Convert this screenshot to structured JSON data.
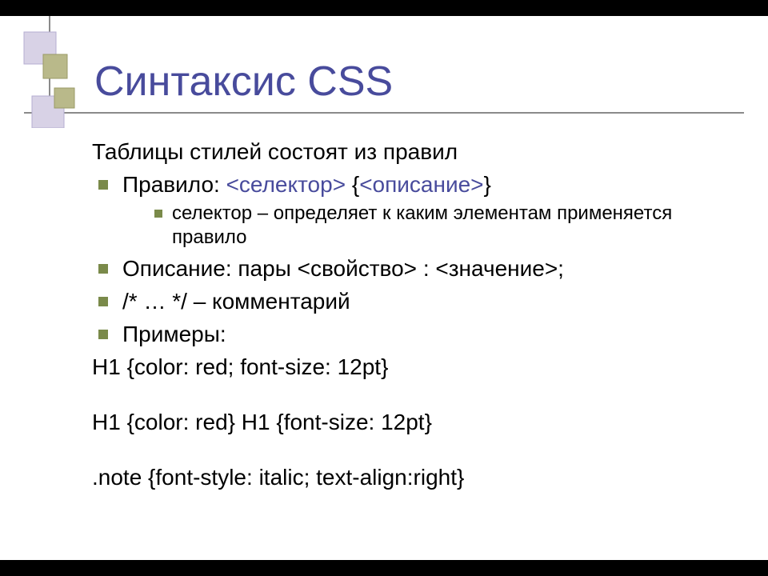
{
  "title": "Синтаксис CSS",
  "intro": "Таблицы стилей состоят из правил",
  "bullets": [
    {
      "pre": "Правило: ",
      "accent1": "<селектор>",
      "mid": " {",
      "accent2": "<описание>",
      "post": "}",
      "sub": [
        "селектор – определяет к каким элементам применяется правило"
      ]
    },
    {
      "text": "Описание: пары <свойство> : <значение>;"
    },
    {
      "text": "/* … */ – комментарий"
    },
    {
      "text": "Примеры:"
    }
  ],
  "examples": [
    "H1 {color: red; font-size: 12pt}",
    "H1 {color: red} H1 {font-size: 12pt}",
    ".note {font-style: italic; text-align:right}"
  ]
}
